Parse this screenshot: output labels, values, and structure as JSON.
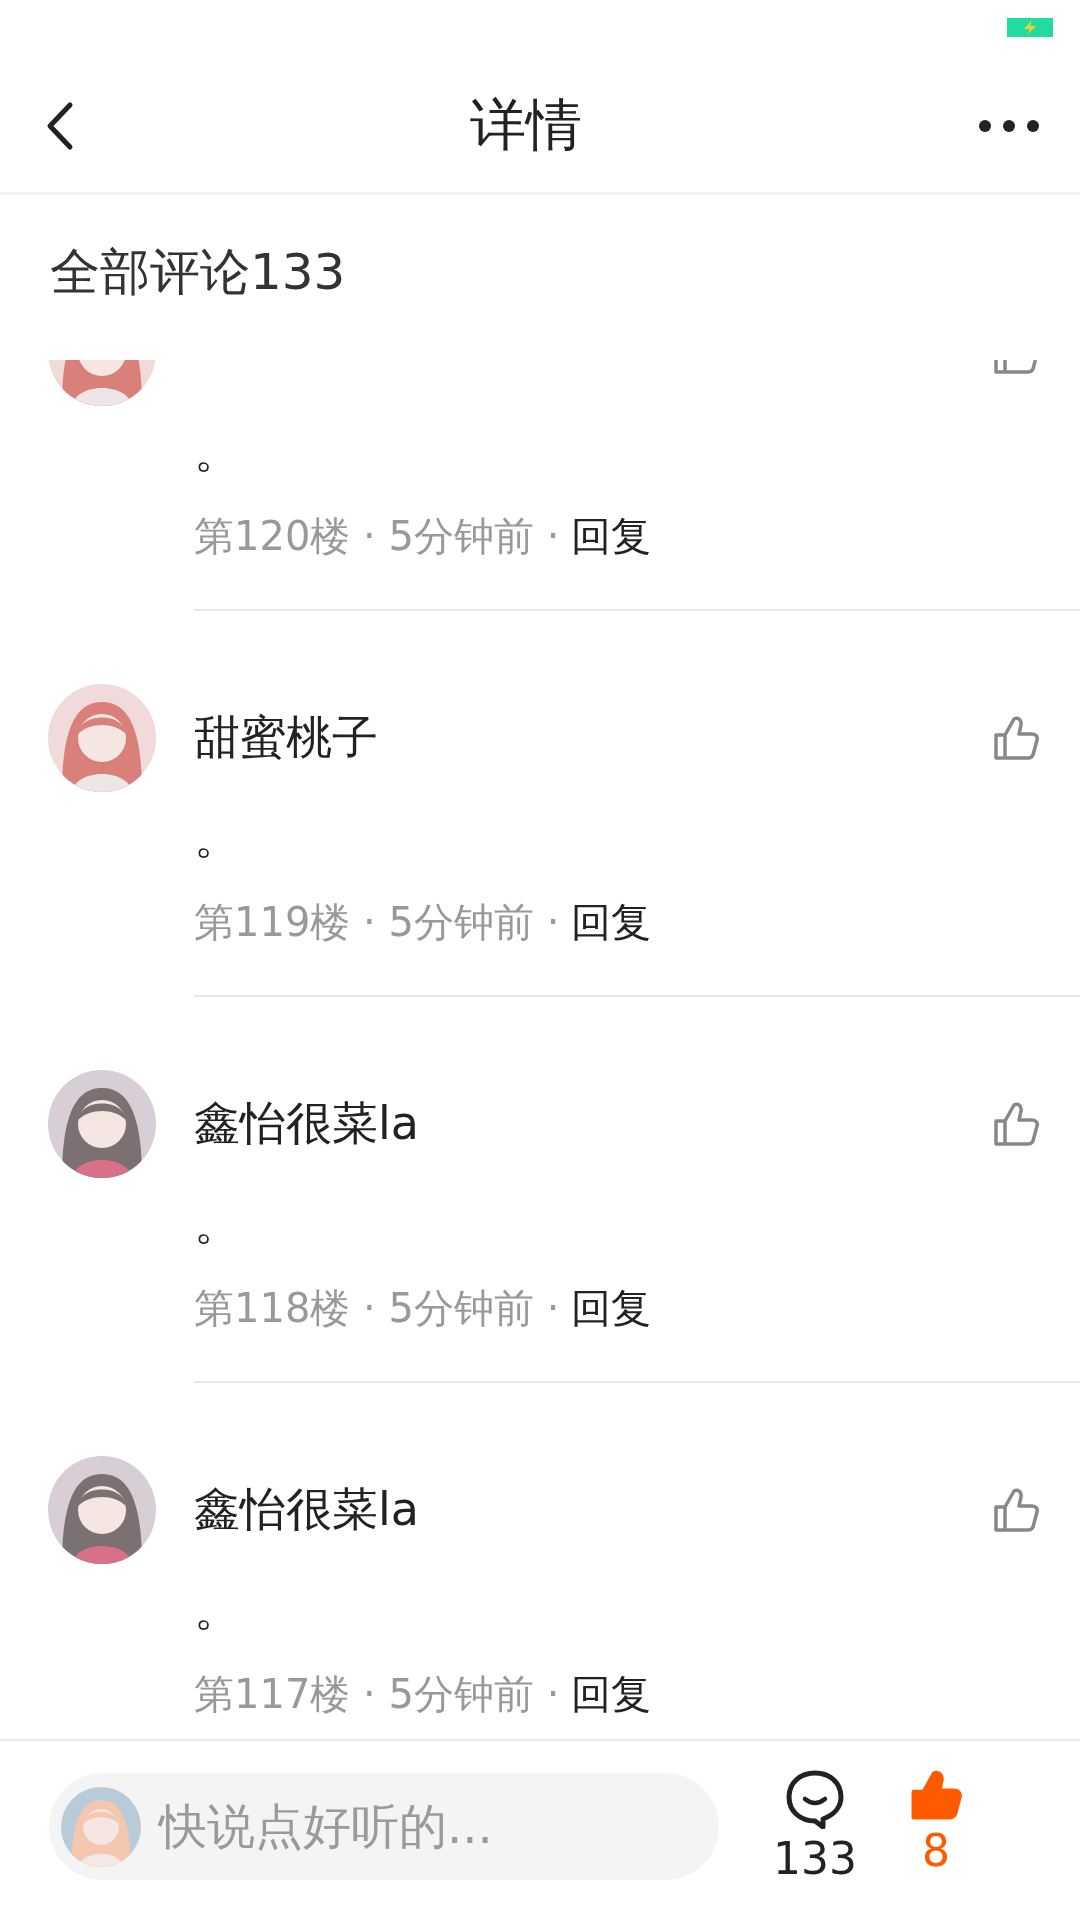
{
  "nav": {
    "title": "详情"
  },
  "comments_header": "全部评论133",
  "comments": [
    {
      "text": "。",
      "meta": "第120楼 · 5分钟前 ·",
      "reply": "回复",
      "liked": false
    },
    {
      "name": "甜蜜桃子",
      "text": "。",
      "meta": "第119楼 · 5分钟前 ·",
      "reply": "回复",
      "liked": false
    },
    {
      "name": "鑫怡很菜la",
      "text": "。",
      "meta": "第118楼 · 5分钟前 ·",
      "reply": "回复",
      "liked": false
    },
    {
      "name": "鑫怡很菜la",
      "text": "。",
      "meta": "第117楼 · 5分钟前 ·",
      "reply": "回复",
      "liked": false
    }
  ],
  "bottom_bar": {
    "placeholder": "快说点好听的...",
    "comment_count": "133",
    "like_count": "8",
    "liked": true
  }
}
